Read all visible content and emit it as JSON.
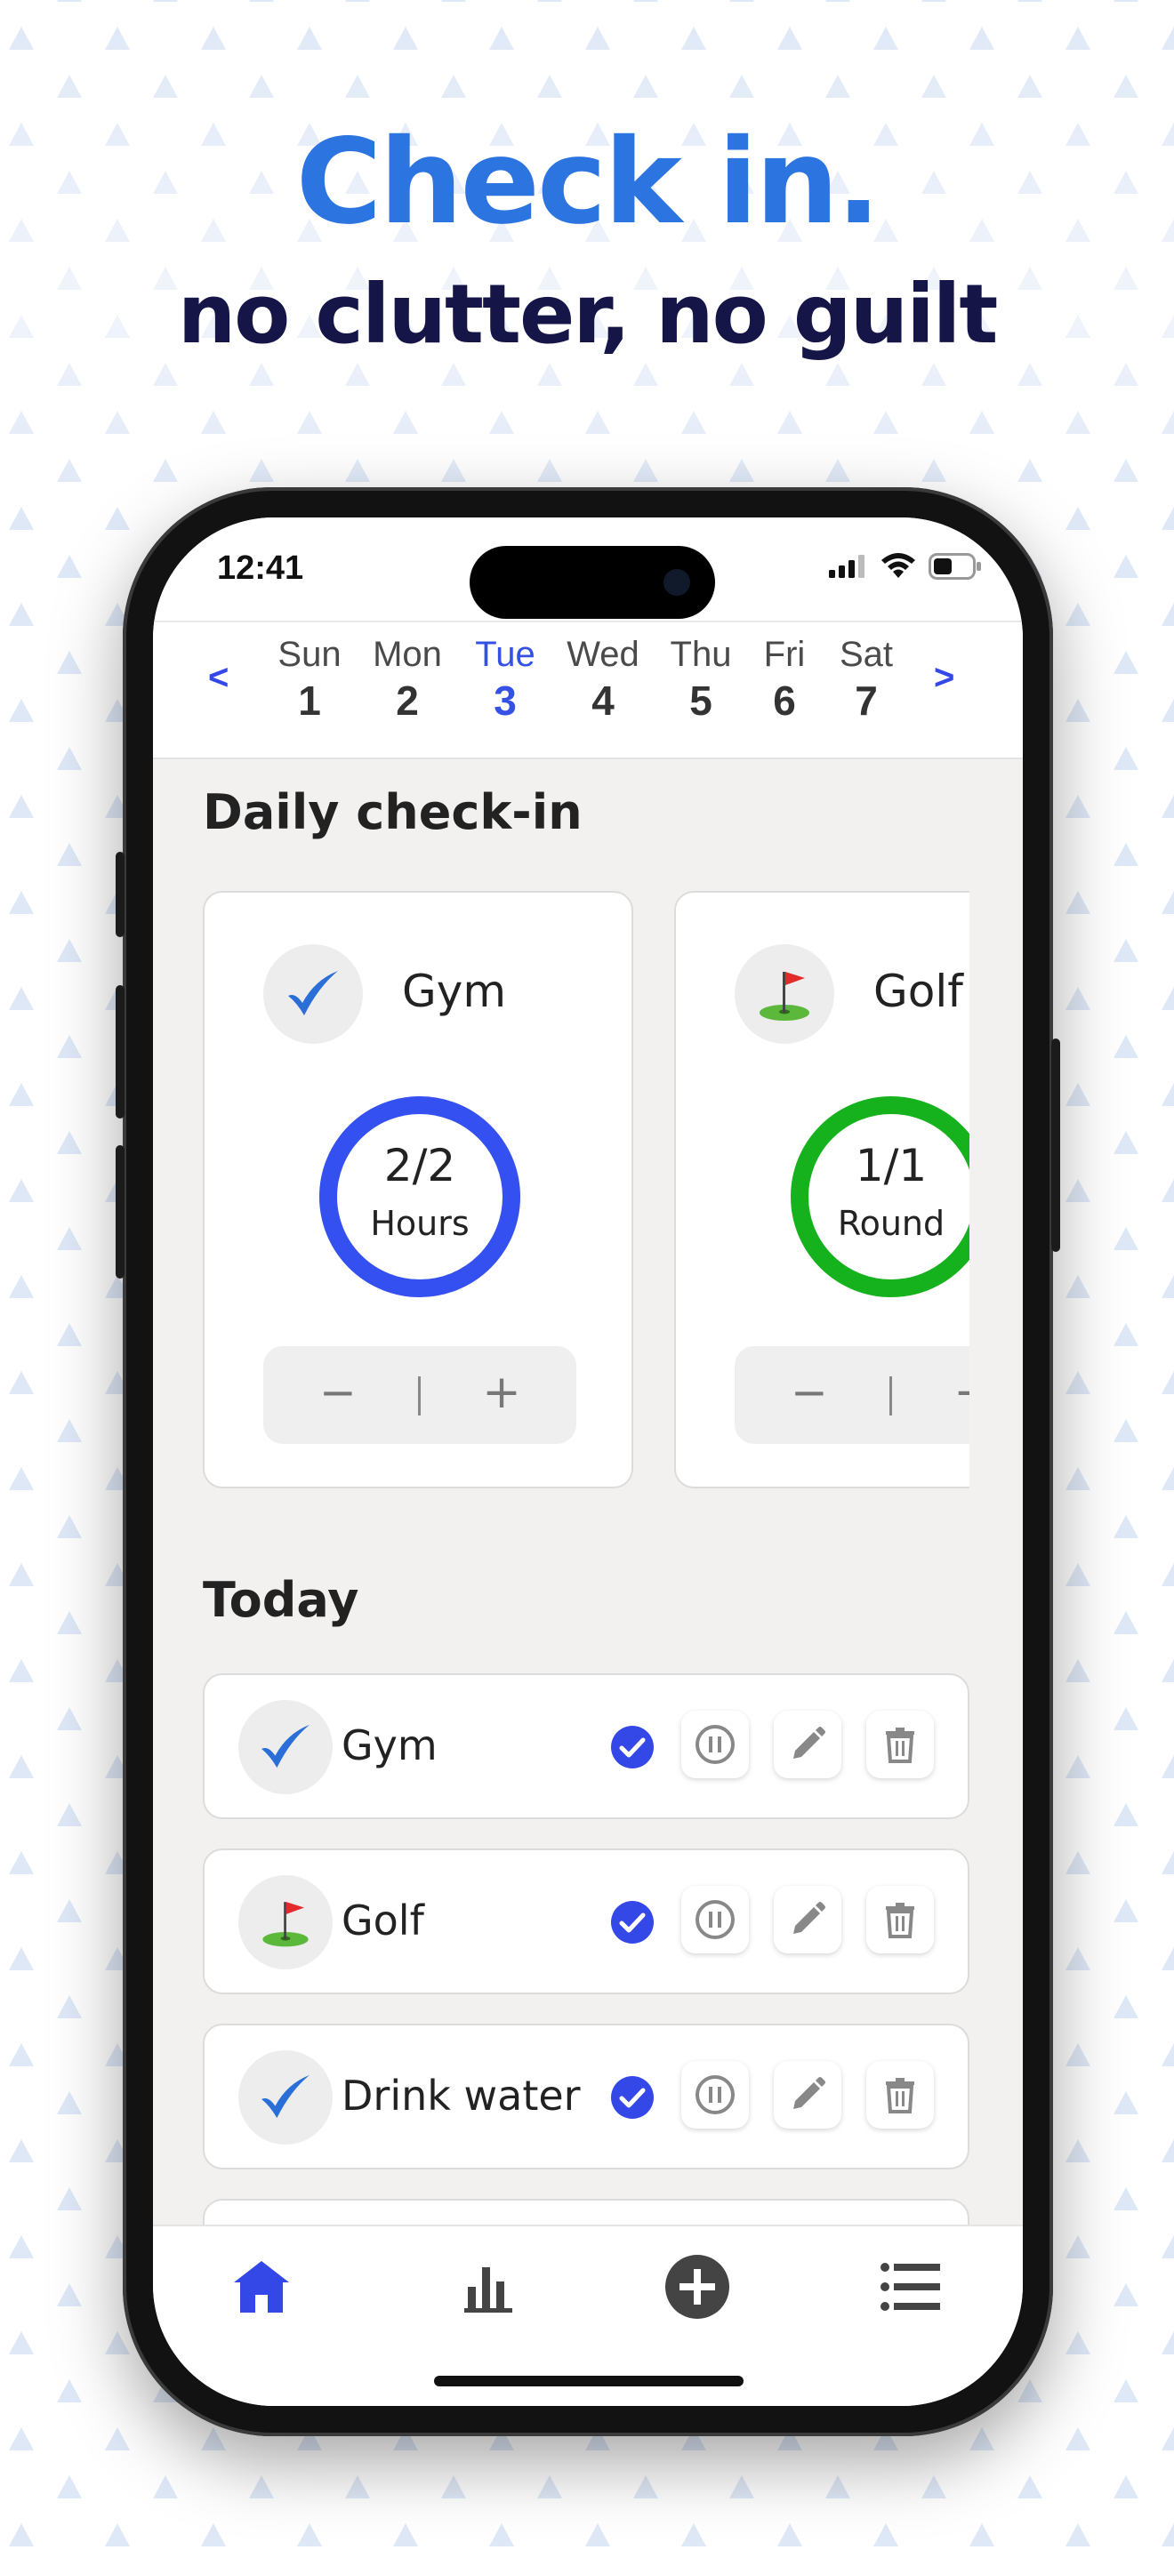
{
  "promo": {
    "headline": "Check in.",
    "subheadline": "no clutter, no guilt"
  },
  "colors": {
    "accent": "#3550e4",
    "headline_blue": "#2c74e0",
    "headline_navy": "#151548",
    "ring_blue": "#3450f0",
    "ring_green": "#16b21e"
  },
  "status_bar": {
    "time": "12:41"
  },
  "week_nav": {
    "prev": "<",
    "next": ">",
    "days": [
      {
        "name": "Sun",
        "date": "1"
      },
      {
        "name": "Mon",
        "date": "2"
      },
      {
        "name": "Tue",
        "date": "3"
      },
      {
        "name": "Wed",
        "date": "4"
      },
      {
        "name": "Thu",
        "date": "5"
      },
      {
        "name": "Fri",
        "date": "6"
      },
      {
        "name": "Sat",
        "date": "7"
      }
    ],
    "selected_index": 2
  },
  "daily": {
    "title": "Daily check-in",
    "cards": [
      {
        "name": "Gym",
        "icon": "check-icon",
        "value": "2/2",
        "unit": "Hours",
        "progress": 1.0
      },
      {
        "name": "Golf",
        "icon": "golf-flag-icon",
        "value": "1/1",
        "unit": "Round",
        "progress": 1.0
      }
    ],
    "stepper": {
      "minus": "−",
      "plus": "+"
    }
  },
  "today": {
    "title": "Today",
    "items": [
      {
        "label": "Gym",
        "icon": "check-icon",
        "done": true
      },
      {
        "label": "Golf",
        "icon": "golf-flag-icon",
        "done": true
      },
      {
        "label": "Drink water",
        "icon": "check-icon",
        "done": true
      }
    ]
  },
  "tabs": [
    {
      "name": "home",
      "icon": "home-icon",
      "active": true
    },
    {
      "name": "stats",
      "icon": "bar-chart-icon",
      "active": false
    },
    {
      "name": "add",
      "icon": "add-circle-icon",
      "active": false
    },
    {
      "name": "list",
      "icon": "list-icon",
      "active": false
    }
  ]
}
